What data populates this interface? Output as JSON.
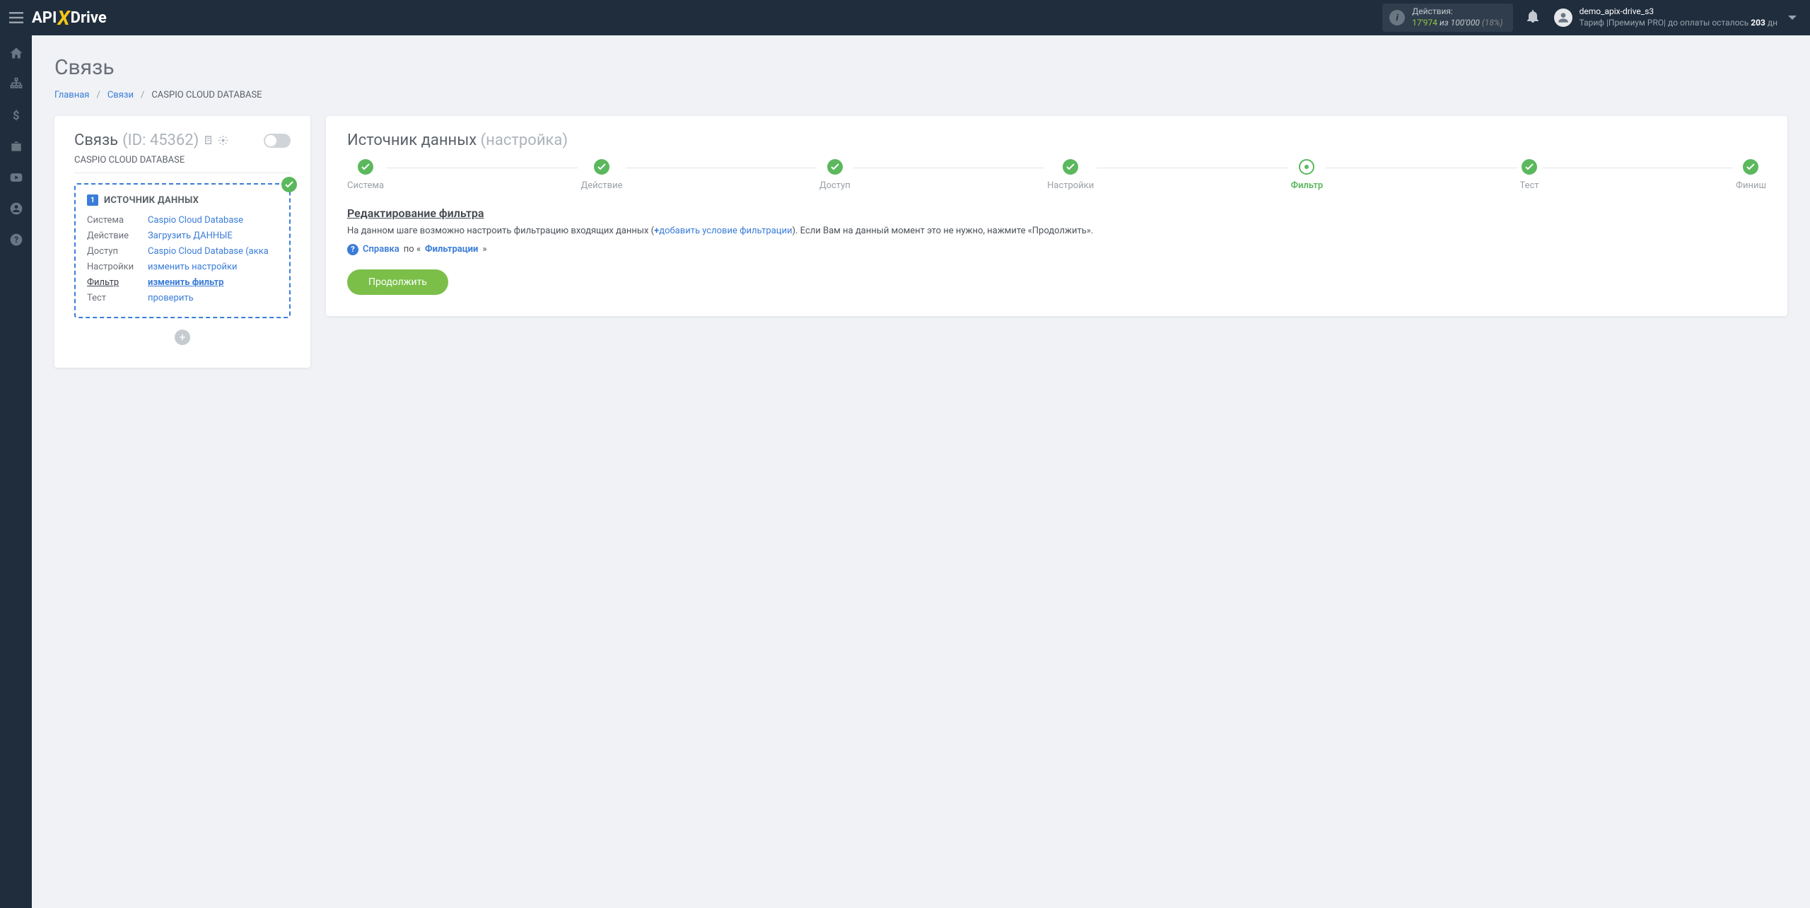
{
  "header": {
    "brand": {
      "pre": "API",
      "x": "X",
      "post": "Drive"
    },
    "actions": {
      "label": "Действия:",
      "used": "17'974",
      "of": "из",
      "limit": "100'000",
      "pct": "(18%)"
    },
    "user": {
      "name": "demo_apix-drive_s3",
      "tariff_pre": "Тариф |Премиум PRO| до оплаты осталось ",
      "days": "203",
      "tariff_post": " дн"
    }
  },
  "page": {
    "title": "Связь"
  },
  "breadcrumb": {
    "home": "Главная",
    "links": "Связи",
    "current": "CASPIO CLOUD DATABASE"
  },
  "left": {
    "title": "Связь",
    "id": "(ID: 45362)",
    "conn_name": "CASPIO CLOUD DATABASE",
    "source": {
      "badge": "1",
      "title": "ИСТОЧНИК ДАННЫХ",
      "rows": [
        {
          "lbl": "Система",
          "val": "Caspio Cloud Database"
        },
        {
          "lbl": "Действие",
          "val": "Загрузить ДАННЫЕ"
        },
        {
          "lbl": "Доступ",
          "val": "Caspio Cloud Database (акка"
        },
        {
          "lbl": "Настройки",
          "val": "изменить настройки"
        },
        {
          "lbl": "Фильтр",
          "val": "изменить фильтр"
        },
        {
          "lbl": "Тест",
          "val": "проверить"
        }
      ],
      "active_row": 4
    }
  },
  "right": {
    "title": "Источник данных ",
    "subtitle": "(настройка)",
    "steps": [
      "Система",
      "Действие",
      "Доступ",
      "Настройки",
      "Фильтр",
      "Тест",
      "Финиш"
    ],
    "current_step": 4,
    "section_head": "Редактирование фильтра",
    "desc_pre": "На данном шаге возможно настроить фильтрацию входящих данных (",
    "add_filter": "добавить условие фильтрации",
    "desc_post": "). Если Вам на данный момент это не нужно, нажмите «Продолжить».",
    "help": {
      "link": "Справка",
      "mid": " по «",
      "topic": "Фильтрации",
      "end": "»"
    },
    "continue": "Продолжить"
  }
}
